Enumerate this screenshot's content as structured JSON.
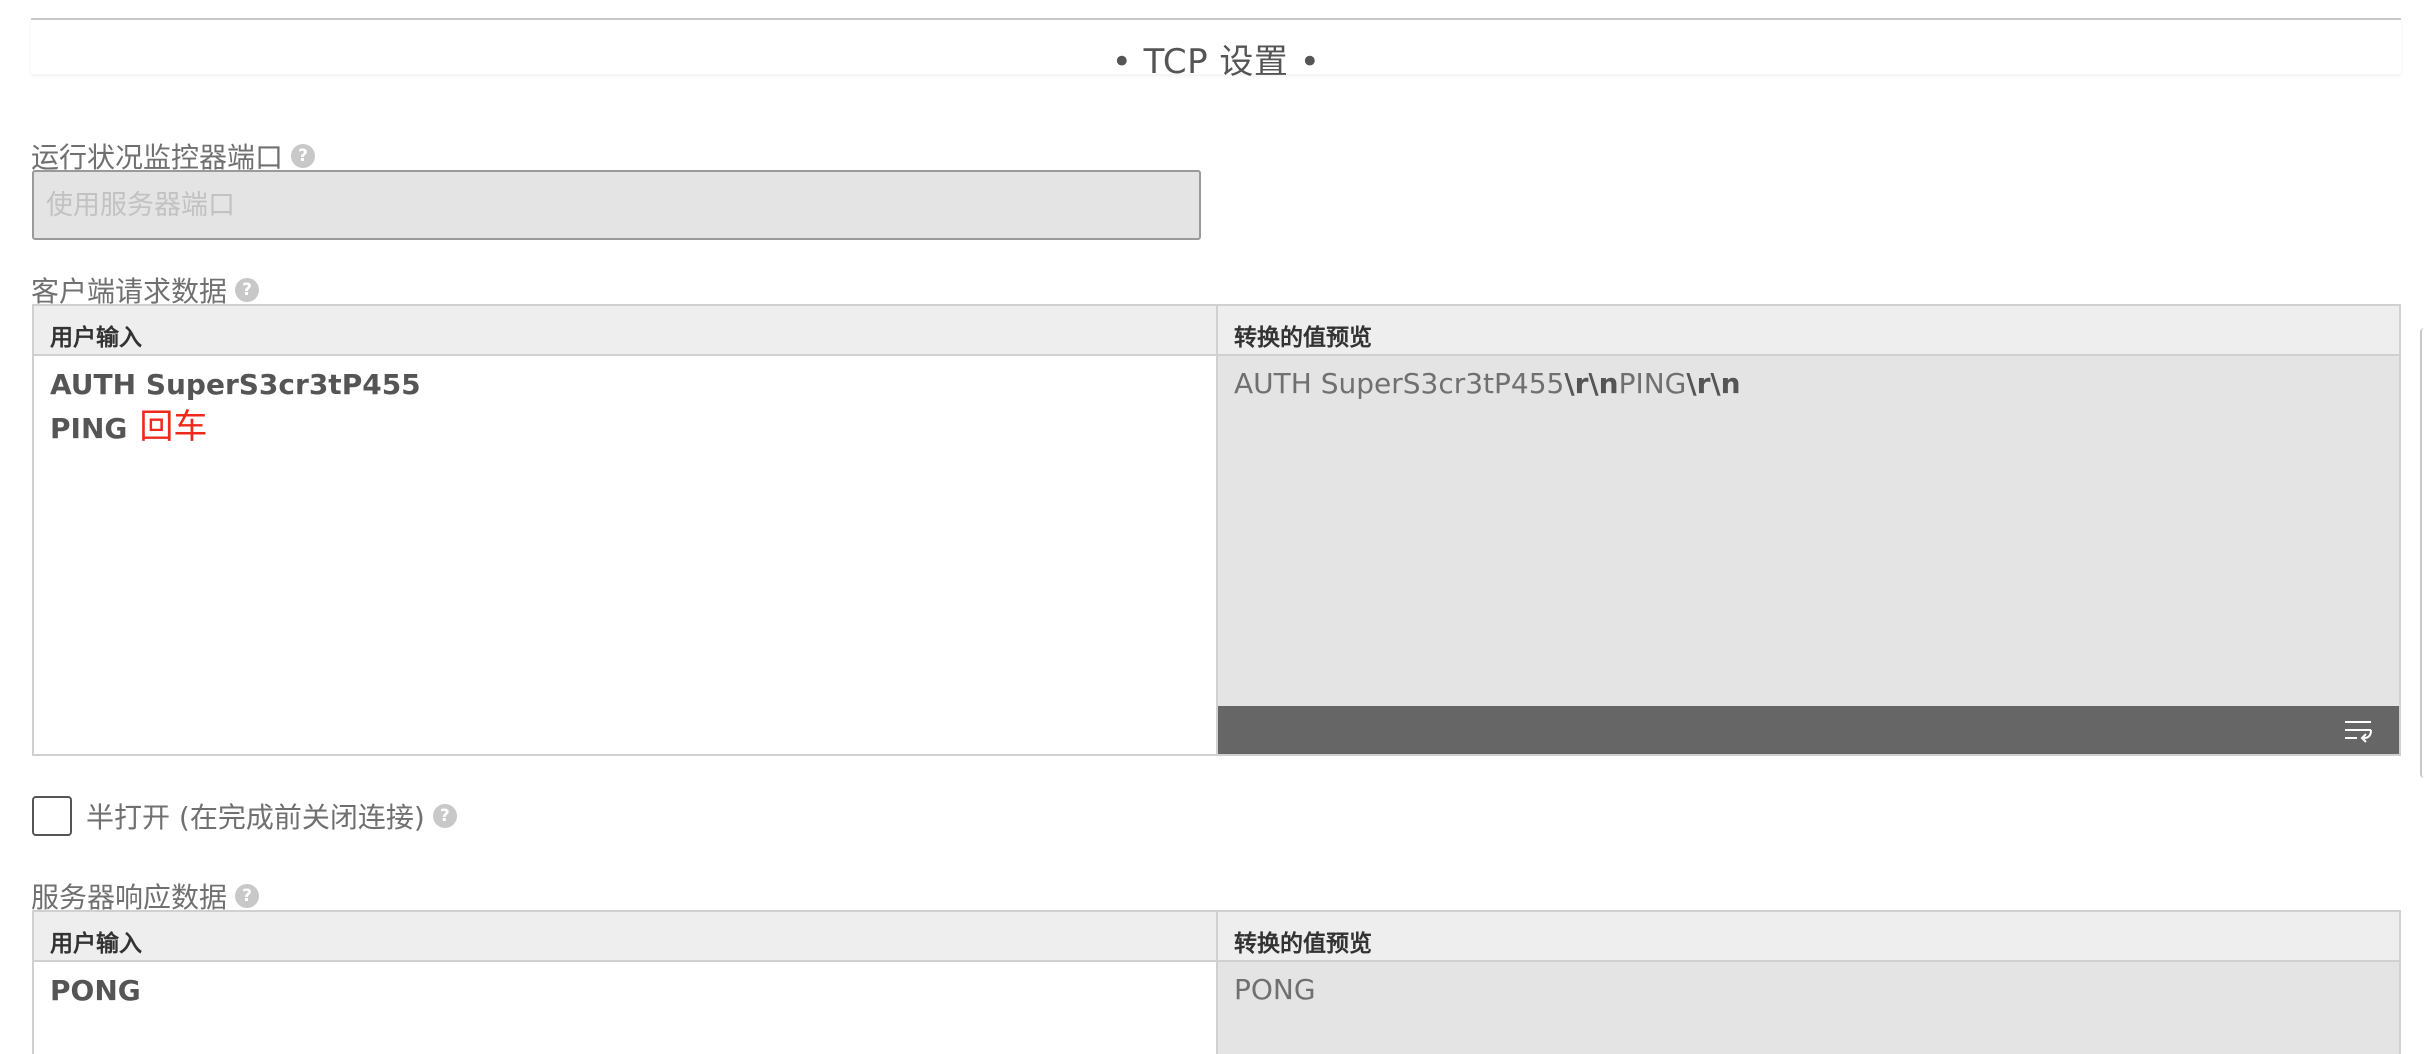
{
  "section": {
    "title": "• TCP 设置 •"
  },
  "monitor_port": {
    "label": "运行状况监控器端口",
    "placeholder": "使用服务器端口",
    "value": ""
  },
  "client_request": {
    "label": "客户端请求数据",
    "user_input_header": "用户输入",
    "preview_header": "转换的值预览",
    "lines": [
      "AUTH SuperS3cr3tP455",
      "PING"
    ],
    "enter_annotation": "回车",
    "preview_parts": [
      {
        "text": "AUTH SuperS3cr3tP455",
        "bold": false
      },
      {
        "text": "\\r\\n",
        "bold": true
      },
      {
        "text": "PING",
        "bold": false
      },
      {
        "text": "\\r\\n",
        "bold": true
      }
    ]
  },
  "half_open": {
    "label": "半打开 (在完成前关闭连接)",
    "checked": false
  },
  "server_response": {
    "label": "服务器响应数据",
    "user_input_header": "用户输入",
    "preview_header": "转换的值预览",
    "value": "PONG",
    "preview": "PONG"
  },
  "icons": {
    "help": "question-circle-icon",
    "wrap": "text-wrap-icon"
  },
  "colors": {
    "accent_red": "#ee2a1b",
    "preview_bar": "#666666",
    "preview_bg": "#e4e4e4"
  }
}
